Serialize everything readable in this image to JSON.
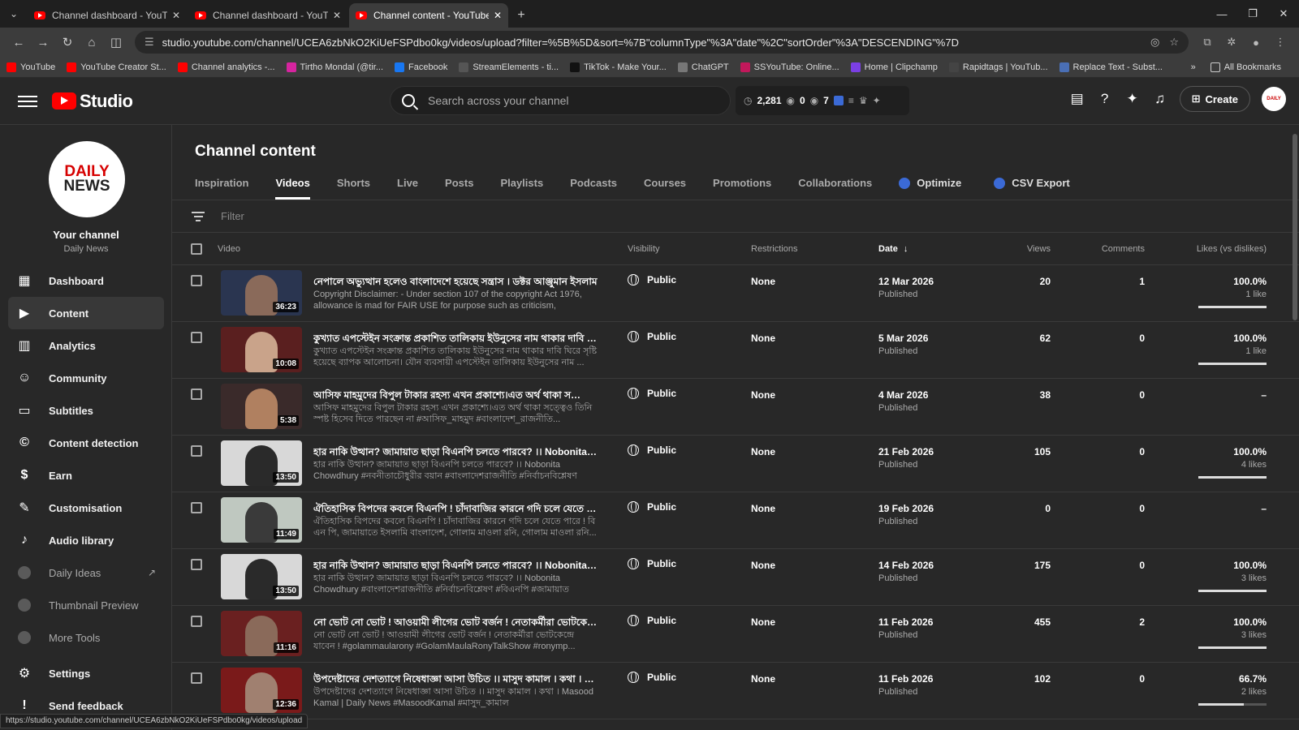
{
  "browser": {
    "tabs": [
      {
        "title": "Channel dashboard - YouTube"
      },
      {
        "title": "Channel dashboard - YouTube S"
      },
      {
        "title": "Channel content - YouTube Stu"
      }
    ],
    "url": "studio.youtube.com/channel/UCEA6zbNkO2KiUeFSPdbo0kg/videos/upload?filter=%5B%5D&sort=%7B\"columnType\"%3A\"date\"%2C\"sortOrder\"%3A\"DESCENDING\"%7D",
    "bookmarks": [
      {
        "label": "YouTube",
        "color": "#ff0000"
      },
      {
        "label": "YouTube Creator St...",
        "color": "#ff0000"
      },
      {
        "label": "Channel analytics -...",
        "color": "#ff0000"
      },
      {
        "label": "Tirtho Mondal (@tir...",
        "color": "#d6249f"
      },
      {
        "label": "Facebook",
        "color": "#1877f2"
      },
      {
        "label": "StreamElements - ti...",
        "color": "#555555"
      },
      {
        "label": "TikTok - Make Your...",
        "color": "#111111"
      },
      {
        "label": "ChatGPT",
        "color": "#777777"
      },
      {
        "label": "SSYouTube: Online...",
        "color": "#c2185b"
      },
      {
        "label": "Home | Clipchamp",
        "color": "#7b3fe4"
      },
      {
        "label": "Rapidtags | YouTub...",
        "color": "#444444"
      },
      {
        "label": "Replace Text - Subst...",
        "color": "#4a6fb5"
      }
    ],
    "all_bookmarks": "All Bookmarks",
    "status_url": "https://studio.youtube.com/channel/UCEA6zbNkO2KiUeFSPdbo0kg/videos/upload"
  },
  "header": {
    "logo_text": "Studio",
    "search_placeholder": "Search across your channel",
    "stats": {
      "views": "2,281",
      "a": "0",
      "b": "7"
    },
    "create_label": "Create"
  },
  "sidebar": {
    "avatar_line1": "DAILY",
    "avatar_line2": "NEWS",
    "channel_title": "Your channel",
    "channel_name": "Daily News",
    "items": [
      {
        "label": "Dashboard",
        "icon": "dashboard-icon"
      },
      {
        "label": "Content",
        "icon": "content-icon"
      },
      {
        "label": "Analytics",
        "icon": "analytics-icon"
      },
      {
        "label": "Community",
        "icon": "community-icon"
      },
      {
        "label": "Subtitles",
        "icon": "subtitles-icon"
      },
      {
        "label": "Content detection",
        "icon": "copyright-icon"
      },
      {
        "label": "Earn",
        "icon": "dollar-icon"
      },
      {
        "label": "Customisation",
        "icon": "wand-icon"
      },
      {
        "label": "Audio library",
        "icon": "audio-library-icon"
      },
      {
        "label": "Daily Ideas",
        "icon": "extension-icon"
      },
      {
        "label": "Thumbnail Preview",
        "icon": "extension-icon"
      },
      {
        "label": "More Tools",
        "icon": "extension-icon"
      },
      {
        "label": "Settings",
        "icon": "gear-icon"
      },
      {
        "label": "Send feedback",
        "icon": "feedback-icon"
      }
    ]
  },
  "main": {
    "title": "Channel content",
    "tabs": [
      "Inspiration",
      "Videos",
      "Shorts",
      "Live",
      "Posts",
      "Playlists",
      "Podcasts",
      "Courses",
      "Promotions",
      "Collaborations",
      "Optimize",
      "CSV Export"
    ],
    "filter_placeholder": "Filter",
    "columns": {
      "video": "Video",
      "visibility": "Visibility",
      "restrictions": "Restrictions",
      "date": "Date",
      "views": "Views",
      "comments": "Comments",
      "likes": "Likes (vs dislikes)"
    },
    "videos": [
      {
        "title": "নেপালে অভ্যুত্থান হলেও বাংলাদেশে হয়েছে সন্ত্রাস । ডক্টর আঞ্জুমান ইসলাম",
        "desc": "Copyright Disclaimer: - Under section 107 of the copyright Act 1976, allowance is mad for FAIR USE for purpose such as criticism, comment,...",
        "duration": "36:23",
        "visibility": "Public",
        "restrictions": "None",
        "date": "12 Mar 2026",
        "status": "Published",
        "views": "20",
        "comments": "1",
        "likes": "100.0%",
        "like_count": "1 like",
        "like_ratio": 1.0,
        "thumb_bg": "#2a3550",
        "fig": "#8a6a5a"
      },
      {
        "title": "কুখ্যাত এপস্টেইন সংক্রান্ত প্রকাশিত তালিকায় ইউনুসের নাম থাকার দাবি ঘি...",
        "desc": "কুখ্যাত এপস্টেইন সংক্রান্ত প্রকাশিত তালিকায় ইউনুসের নাম থাকার দাবি ঘিরে সৃষ্টি হয়েছে ব্যাপক আলোচনা। যৌন ব্যবসায়ী এপস্টেইন তালিকায় ইউনুসের নাম ...",
        "duration": "10:08",
        "visibility": "Public",
        "restrictions": "None",
        "date": "5 Mar 2026",
        "status": "Published",
        "views": "62",
        "comments": "0",
        "likes": "100.0%",
        "like_count": "1 like",
        "like_ratio": 1.0,
        "thumb_bg": "#5a1f1f",
        "fig": "#c9a38a"
      },
      {
        "title": "আসিফ মাহমুদের বিপুল টাকার রহস্য এখন প্রকাশ্যে।এত অর্থ থাকা সত্ত্বেও তি...",
        "desc": "আসিফ মাহমুদের বিপুল টাকার রহস্য এখন প্রকাশ্যে।এত অর্থ থাকা সত্ত্বেও তিনি স্পষ্ট হিসেব দিতে পারছেন না #আসিফ_মাহমুদ #বাংলাদেশ_রাজনীতি...",
        "duration": "5:38",
        "visibility": "Public",
        "restrictions": "None",
        "date": "4 Mar 2026",
        "status": "Published",
        "views": "38",
        "comments": "0",
        "likes": "–",
        "like_count": "",
        "like_ratio": null,
        "thumb_bg": "#3a2a2a",
        "fig": "#b08060"
      },
      {
        "title": "হার নাকি উত্থান? জামায়াত ছাড়া বিএনপি চলতে পারবে? ।। Nobonita Chow...",
        "desc": "হার নাকি উত্থান? জামায়াত ছাড়া বিএনপি চলতে পারবে? ।। Nobonita Chowdhury #নবনীতাচৌধুরীর বয়ান #বাংলাদেশরাজনীতি #নির্বাচনবিশ্লেষণ #বিএনপি #জামায়া...",
        "duration": "13:50",
        "visibility": "Public",
        "restrictions": "None",
        "date": "21 Feb 2026",
        "status": "Published",
        "views": "105",
        "comments": "0",
        "likes": "100.0%",
        "like_count": "4 likes",
        "like_ratio": 1.0,
        "thumb_bg": "#d8d8d8",
        "fig": "#2a2a2a"
      },
      {
        "title": "ঐতিহাসিক বিপদের কবলে বিএনপি ! চাঁদাবাজির কারনে গদি চলে যেতে পারে...",
        "desc": "ঐতিহাসিক বিপদের কবলে বিএনপি ! চাঁদাবাজির কারনে গদি চলে যেতে পারে ! বি এন পি, জামায়াতে ইসলামি বাংলাদেশ, গোলাম মাওলা রনি, গোলাম মাওলা রনি...",
        "duration": "11:49",
        "visibility": "Public",
        "restrictions": "None",
        "date": "19 Feb 2026",
        "status": "Published",
        "views": "0",
        "comments": "0",
        "likes": "–",
        "like_count": "",
        "like_ratio": null,
        "thumb_bg": "#bfc8c0",
        "fig": "#3a3a3a"
      },
      {
        "title": "হার নাকি উত্থান? জামায়াত ছাড়া বিএনপি চলতে পারবে? ।। Nobonita Chowd...",
        "desc": "হার নাকি উত্থান? জামায়াত ছাড়া বিএনপি চলতে পারবে? ।। Nobonita Chowdhury #বাংলাদেশরাজনীতি #নির্বাচনবিশ্লেষণ #বিএনপি #জামায়াত #বিএনপিজামায়াত...",
        "duration": "13:50",
        "visibility": "Public",
        "restrictions": "None",
        "date": "14 Feb 2026",
        "status": "Published",
        "views": "175",
        "comments": "0",
        "likes": "100.0%",
        "like_count": "3 likes",
        "like_ratio": 1.0,
        "thumb_bg": "#d8d8d8",
        "fig": "#2a2a2a"
      },
      {
        "title": "নো ভোট নো ভোট ! আওয়ামী লীগের ভোট বর্জন ! নেতাকর্মীরা ভোটকেন্দ্রে যা...",
        "desc": "নো ভোট নো ভোট ! আওয়ামী লীগের ভোট বর্জন ! নেতাকর্মীরা ভোটকেন্দ্রে যাবেন ! #golammaularony #GolamMaulaRonyTalkShow #ronymp...",
        "duration": "11:16",
        "visibility": "Public",
        "restrictions": "None",
        "date": "11 Feb 2026",
        "status": "Published",
        "views": "455",
        "comments": "2",
        "likes": "100.0%",
        "like_count": "3 likes",
        "like_ratio": 1.0,
        "thumb_bg": "#6a2020",
        "fig": "#8a6a5a"
      },
      {
        "title": "উপদেষ্টাদের দেশত্যাগে নিষেধাজ্ঞা আসা উচিত ।। মাসুদ কামাল । কথা । Mas...",
        "desc": "উপদেষ্টাদের দেশত্যাগে নিষেধাজ্ঞা আসা উচিত ।। মাসুদ কামাল । কথা । Masood Kamal | Daily News #MasoodKamal #মাসুদ_কামাল #উপদেষ্টাদের_দেশত্যাগ...",
        "duration": "12:36",
        "visibility": "Public",
        "restrictions": "None",
        "date": "11 Feb 2026",
        "status": "Published",
        "views": "102",
        "comments": "0",
        "likes": "66.7%",
        "like_count": "2 likes",
        "like_ratio": 0.667,
        "thumb_bg": "#7a1a1a",
        "fig": "#a08070"
      }
    ]
  }
}
